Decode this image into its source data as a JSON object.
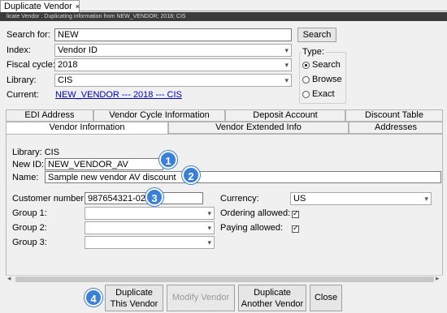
{
  "window": {
    "tab_title": "Duplicate Vendor",
    "tab_close": "×",
    "status": "licate Vendor : Duplicating  information from NEW_VENDOR; 2018; CIS"
  },
  "search": {
    "label": "Search for:",
    "value": "NEW",
    "button": "Search"
  },
  "index": {
    "label": "Index:",
    "value": "Vendor ID"
  },
  "fiscal": {
    "label": "Fiscal cycle:",
    "value": "2018"
  },
  "library": {
    "label": "Library:",
    "value": "CIS"
  },
  "current": {
    "label": "Current:",
    "value": "NEW_VENDOR --- 2018 --- CIS"
  },
  "type": {
    "label": "Type:",
    "options": [
      {
        "label": "Search",
        "selected": true
      },
      {
        "label": "Browse",
        "selected": false
      },
      {
        "label": "Exact",
        "selected": false
      }
    ]
  },
  "tabs_row1": [
    "EDI Address",
    "Vendor Cycle Information",
    "Deposit Account",
    "Discount Table"
  ],
  "tabs_row2": [
    "Vendor Information",
    "Vendor Extended Info",
    "Addresses"
  ],
  "vendor_info": {
    "library_line": "Library: CIS",
    "new_id_label": "New ID:",
    "new_id_value": "NEW_VENDOR_AV",
    "name_label": "Name:",
    "name_value": "Sample new vendor AV discount",
    "customer_number_label": "Customer number:",
    "customer_number_value": "987654321-02",
    "group1_label": "Group 1:",
    "group2_label": "Group 2:",
    "group3_label": "Group 3:",
    "currency_label": "Currency:",
    "currency_value": "US",
    "ordering_label": "Ordering allowed:",
    "paying_label": "Paying allowed:"
  },
  "badges": [
    "1",
    "2",
    "3",
    "4"
  ],
  "buttons": {
    "duplicate_this_1": "Duplicate",
    "duplicate_this_2": "This Vendor",
    "modify": "Modify Vendor",
    "duplicate_another_1": "Duplicate",
    "duplicate_another_2": "Another Vendor",
    "close": "Close"
  },
  "icons": {
    "dropdown": "▾",
    "scroll_left": "◂",
    "scroll_right": "▸",
    "check": "✓"
  },
  "colors": {
    "badge": "#3a7fd8",
    "link": "#0000cc",
    "status_bar": "#3b3b3b"
  }
}
